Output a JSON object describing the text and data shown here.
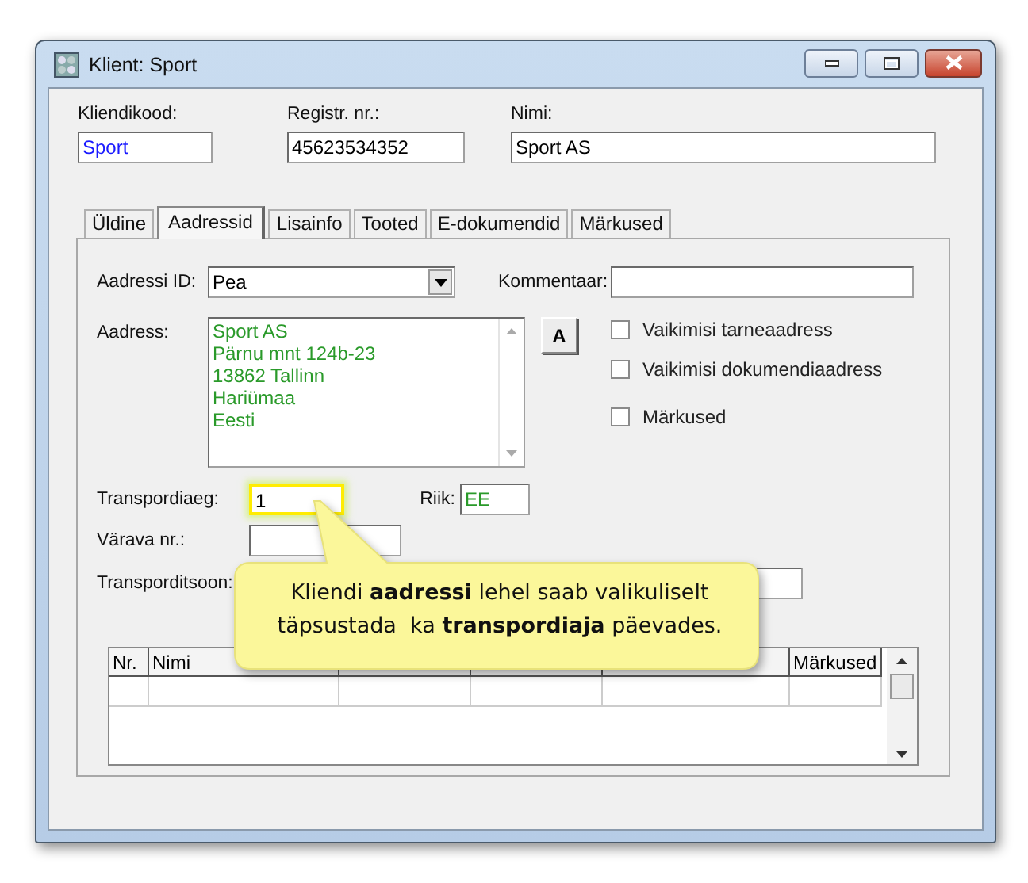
{
  "window": {
    "title": "Klient: Sport"
  },
  "header_fields": [
    {
      "label": "Kliendikood:",
      "value": "Sport",
      "color": "#1a1aff"
    },
    {
      "label": "Registr. nr.:",
      "value": "45623534352",
      "color": "#000000"
    },
    {
      "label": "Nimi:",
      "value": "Sport AS",
      "color": "#000000"
    }
  ],
  "tabs": [
    {
      "label": "Üldine",
      "selected": false
    },
    {
      "label": "Aadressid",
      "selected": true
    },
    {
      "label": "Lisainfo",
      "selected": false
    },
    {
      "label": "Tooted",
      "selected": false
    },
    {
      "label": "E-dokumendid",
      "selected": false
    },
    {
      "label": "Märkused",
      "selected": false
    }
  ],
  "address": {
    "id": {
      "label": "Aadressi ID:",
      "value": "Pea"
    },
    "comment": {
      "label": "Kommentaar:"
    },
    "address": {
      "label": "Aadress:",
      "lines": [
        "Sport AS",
        "Pärnu mnt 124b-23",
        "13862 Tallinn",
        "Hariümaa",
        "Eesti"
      ],
      "color": "#2a9a2a"
    },
    "format_button": "A",
    "checkboxes": [
      {
        "label": "Vaikimisi tarneaadress",
        "checked": false
      },
      {
        "label": "Vaikimisi dokumendiaadress",
        "checked": false
      },
      {
        "label": "Märkused",
        "checked": false
      }
    ],
    "transport_time": {
      "label": "Transpordiaeg:",
      "value": "1",
      "highlighted": true
    },
    "country": {
      "label": "Riik:",
      "value": "EE",
      "color": "#2a9a2a"
    },
    "gate": {
      "label": "Värava nr.:"
    },
    "zone": {
      "label": "Transporditsoon:"
    }
  },
  "table": {
    "columns": [
      {
        "label": "Nr."
      },
      {
        "label": "Nimi"
      },
      {},
      {},
      {},
      {
        "label": "Märkused"
      }
    ]
  },
  "callout": {
    "text": "Kliendi **aadressi** lehel saab valikuliselt täpsustada  ka **transpordiaja** päevades."
  }
}
